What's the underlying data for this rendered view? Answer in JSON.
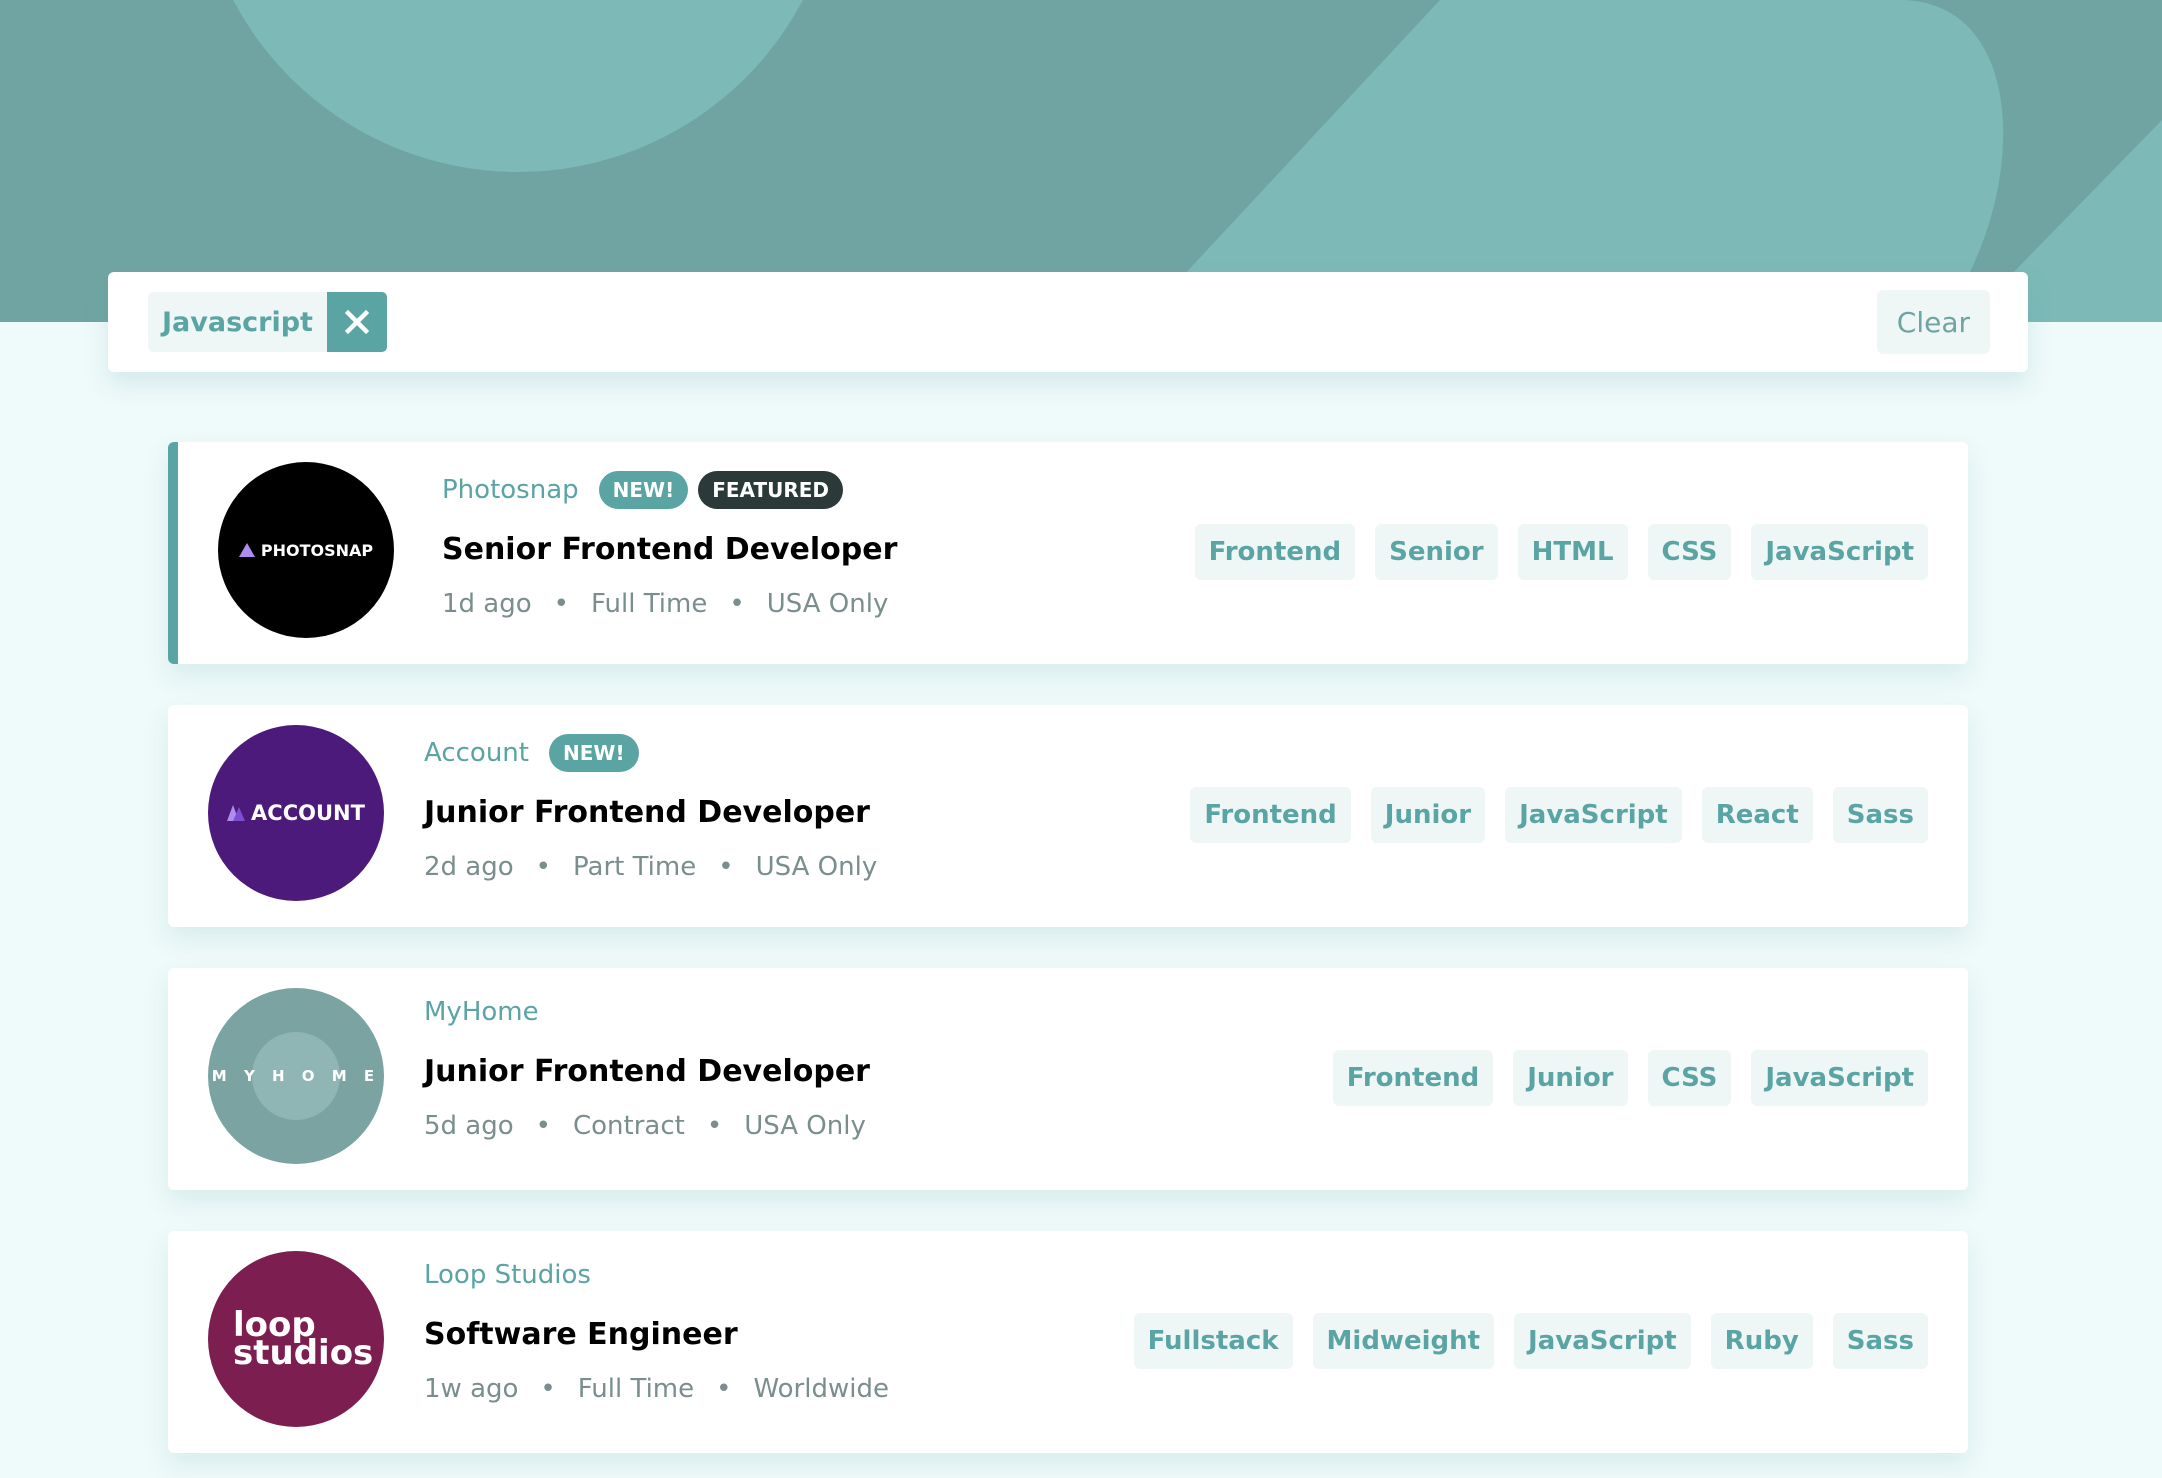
{
  "filter": {
    "active": [
      "Javascript"
    ],
    "clear_label": "Clear"
  },
  "jobs": [
    {
      "company": "Photosnap",
      "logo_text": "PHOTOSNAP",
      "new_label": "NEW!",
      "featured_label": "FEATURED",
      "position": "Senior Frontend Developer",
      "posted": "1d ago",
      "contract": "Full Time",
      "location": "USA Only",
      "tags": [
        "Frontend",
        "Senior",
        "HTML",
        "CSS",
        "JavaScript"
      ]
    },
    {
      "company": "Account",
      "logo_text": "ACCOUNT",
      "new_label": "NEW!",
      "position": "Junior Frontend Developer",
      "posted": "2d ago",
      "contract": "Part Time",
      "location": "USA Only",
      "tags": [
        "Frontend",
        "Junior",
        "JavaScript",
        "React",
        "Sass"
      ]
    },
    {
      "company": "MyHome",
      "logo_text": "M Y H O M E",
      "position": "Junior Frontend Developer",
      "posted": "5d ago",
      "contract": "Contract",
      "location": "USA Only",
      "tags": [
        "Frontend",
        "Junior",
        "CSS",
        "JavaScript"
      ]
    },
    {
      "company": "Loop Studios",
      "logo_text_1": "loop",
      "logo_text_2": "studios",
      "position": "Software Engineer",
      "posted": "1w ago",
      "contract": "Full Time",
      "location": "Worldwide",
      "tags": [
        "Fullstack",
        "Midweight",
        "JavaScript",
        "Ruby",
        "Sass"
      ]
    }
  ],
  "colors": {
    "primary": "#5ba4a4",
    "header": "#6fa4a2",
    "background": "#effafa",
    "tag_bg": "#eef6f6",
    "featured_badge": "#2b3939",
    "photosnap_logo": "#000000",
    "account_logo": "#4b1a7a",
    "myhome_logo": "#7aa3a1",
    "loop_logo": "#7c1e50"
  }
}
